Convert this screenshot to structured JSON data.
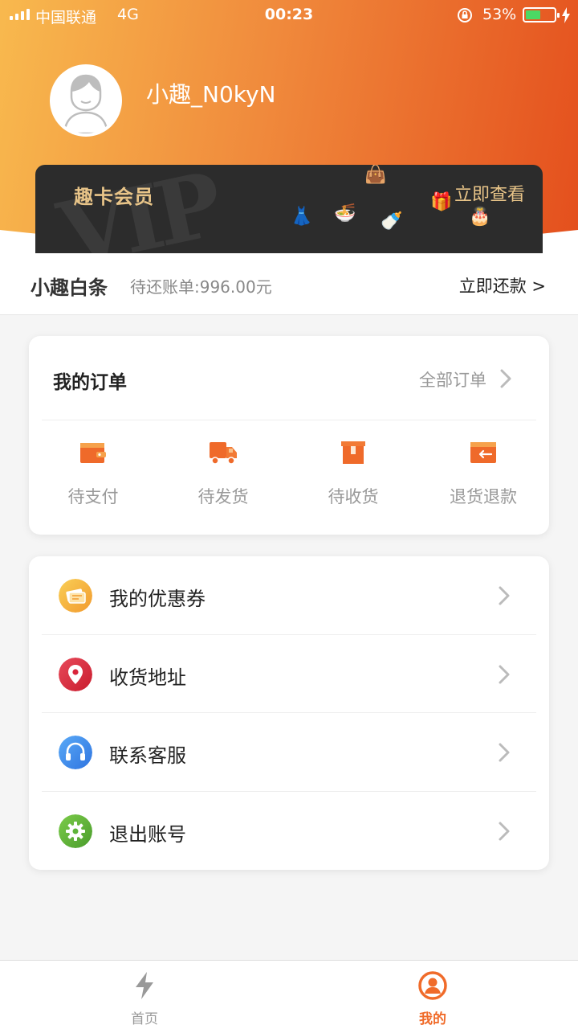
{
  "status_bar": {
    "carrier": "中国联通",
    "network": "4G",
    "time": "00:23",
    "battery_percent": "53%",
    "battery_level": 0.53
  },
  "profile": {
    "username": "小趣_N0kyN",
    "avatar_icon": "user-avatar-icon"
  },
  "vip_card": {
    "title": "趣卡会员",
    "view_label": "立即查看",
    "watermark": "VIP"
  },
  "credit": {
    "title": "小趣白条",
    "bill": "待还账单:996.00元",
    "repay_label": "立即还款 >"
  },
  "orders": {
    "title": "我的订单",
    "all_label": "全部订单",
    "items": [
      {
        "label": "待支付",
        "icon": "wallet-icon"
      },
      {
        "label": "待发货",
        "icon": "truck-icon"
      },
      {
        "label": "待收货",
        "icon": "package-icon"
      },
      {
        "label": "退货退款",
        "icon": "refund-icon"
      }
    ]
  },
  "menu": {
    "items": [
      {
        "label": "我的优惠券",
        "icon": "coupon-icon",
        "color": "#f5a623"
      },
      {
        "label": "收货地址",
        "icon": "location-pin-icon",
        "color": "#d9243a"
      },
      {
        "label": "联系客服",
        "icon": "headphones-icon",
        "color": "#3a8ef0"
      },
      {
        "label": "退出账号",
        "icon": "gear-icon",
        "color": "#5fb43a"
      }
    ]
  },
  "tabbar": {
    "tabs": [
      {
        "label": "首页",
        "icon": "lightning-icon",
        "active": false
      },
      {
        "label": "我的",
        "icon": "user-circle-icon",
        "active": true
      }
    ]
  },
  "colors": {
    "accent": "#f06b2a",
    "header_gradient_start": "#f8b94e",
    "header_gradient_end": "#e44f1d",
    "vip_gold": "#e8c488",
    "tab_active": "#f06b2a",
    "tab_inactive": "#999999"
  }
}
